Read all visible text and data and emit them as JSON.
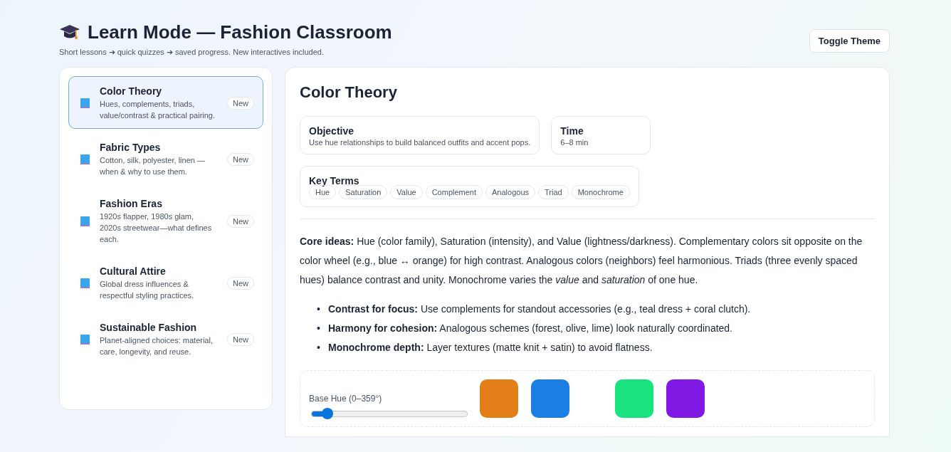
{
  "header": {
    "title": "Learn Mode — Fashion Classroom",
    "subtitle": "Short lessons ➜ quick quizzes ➜ saved progress. New interactives included.",
    "toggle_button": "Toggle Theme"
  },
  "lessons": [
    {
      "title": "Color Theory",
      "description": "Hues, complements, triads, value/contrast & practical pairing.",
      "badge": "New",
      "selected": true
    },
    {
      "title": "Fabric Types",
      "description": "Cotton, silk, polyester, linen — when & why to use them.",
      "badge": "New",
      "selected": false
    },
    {
      "title": "Fashion Eras",
      "description": "1920s flapper, 1980s glam, 2020s streetwear—what defines each.",
      "badge": "New",
      "selected": false
    },
    {
      "title": "Cultural Attire",
      "description": "Global dress influences & respectful styling practices.",
      "badge": "New",
      "selected": false
    },
    {
      "title": "Sustainable Fashion",
      "description": "Planet-aligned choices: material, care, longevity, and reuse.",
      "badge": "New",
      "selected": false
    }
  ],
  "lesson": {
    "title": "Color Theory",
    "objective": {
      "label": "Objective",
      "text": "Use hue relationships to build balanced outfits and accent pops."
    },
    "time": {
      "label": "Time",
      "text": "6–8 min"
    },
    "key_terms": {
      "label": "Key Terms",
      "terms": [
        "Hue",
        "Saturation",
        "Value",
        "Complement",
        "Analogous",
        "Triad",
        "Monochrome"
      ]
    },
    "core_ideas": "**Core ideas:** Hue (color family), Saturation (intensity), and Value (lightness/darkness). Complementary colors sit opposite on the color wheel (e.g., blue ↔ orange) for high contrast. Analogous colors (neighbors) feel harmonious. Triads (three evenly spaced hues) balance contrast and unity. Monochrome varies the *value* and *saturation* of one hue.",
    "bullets": [
      {
        "marker": "•",
        "text": "**Contrast for focus:** Use complements for standout accessories (e.g., teal dress + coral clutch)."
      },
      {
        "marker": "•",
        "text": "**Harmony for cohesion:** Analogous schemes (forest, olive, lime) look naturally coordinated."
      },
      {
        "marker": "•",
        "text": "**Monochrome depth:** Layer textures (matte knit + satin) to avoid flatness."
      }
    ],
    "interactive": {
      "slider_label": "Base Hue (0–359°)",
      "level": 0.1,
      "swatch_groups": [
        [
          {
            "color": "#e37f19"
          },
          {
            "color": "#1a7fe3"
          }
        ],
        [
          {
            "color": "#19e37f"
          },
          {
            "color": "#7f19e3"
          }
        ]
      ]
    }
  }
}
